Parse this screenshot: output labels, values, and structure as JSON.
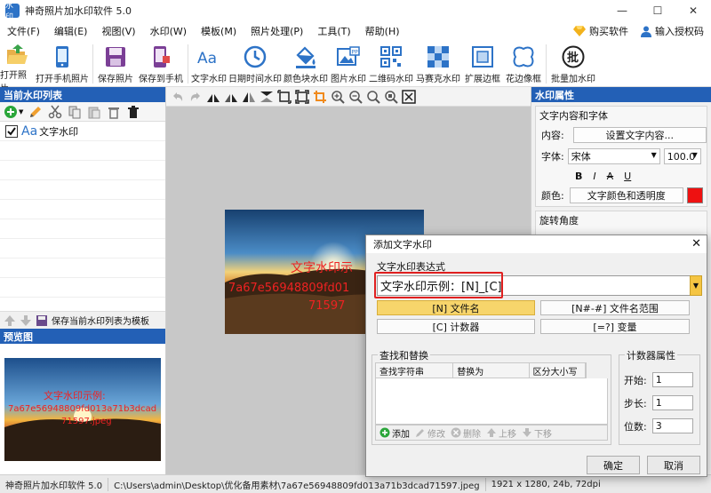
{
  "window": {
    "title": "神奇照片加水印软件 5.0",
    "icon_text": "水印",
    "minimize": "—",
    "maximize": "☐",
    "close": "✕"
  },
  "menu": {
    "items": [
      "文件(F)",
      "编辑(E)",
      "视图(V)",
      "水印(W)",
      "模板(M)",
      "照片处理(P)",
      "工具(T)",
      "帮助(H)"
    ],
    "buy": "购买软件",
    "license": "输入授权码"
  },
  "toolbar": {
    "open_photo": "打开照片",
    "open_phone_photo": "打开手机照片",
    "save_photo": "保存照片",
    "save_to_phone": "保存到手机",
    "text_watermark": "文字水印",
    "datetime_watermark": "日期时间水印",
    "color_block_watermark": "颜色块水印",
    "image_watermark": "图片水印",
    "qrcode_watermark": "二维码水印",
    "mosaic_watermark": "马赛克水印",
    "extend_border": "扩展边框",
    "lace_border": "花边像框",
    "batch_watermark": "批量加水印",
    "batch_icon_text": "批"
  },
  "left_panel": {
    "title": "当前水印列表",
    "items": [
      {
        "icon": "Aa",
        "label": "文字水印",
        "checked": true
      }
    ],
    "save_template": "保存当前水印列表为模板",
    "preview_title": "预览图"
  },
  "canvas": {
    "watermark_line1": "文字水印示",
    "watermark_line2": "7a67e56948809fd01",
    "watermark_line3": "71597",
    "thumb_line1": "文字水印示例:",
    "thumb_line2": "7a67e56948809fd013a71b3dcad",
    "thumb_line3": "71597.jpeg"
  },
  "right_panel": {
    "title": "水印属性",
    "group_title": "文字内容和字体",
    "content_label": "内容:",
    "set_content": "设置文字内容...",
    "font_label": "字体:",
    "font_value": "宋体",
    "font_size": "100.0",
    "style_buttons": [
      "B",
      "I",
      "A",
      "U"
    ],
    "color_label": "颜色:",
    "color_button": "文字颜色和透明度",
    "color_value": "#ee1111",
    "rotation_title": "旋转角度"
  },
  "status": {
    "app": "神奇照片加水印软件 5.0",
    "path": "C:\\Users\\admin\\Desktop\\优化备用素材\\7a67e56948809fd013a71b3dcad71597.jpeg",
    "info": "1921 x 1280, 24b, 72dpi"
  },
  "dialog": {
    "title": "添加文字水印",
    "close": "✕",
    "expr_label": "文字水印表达式",
    "expr_value": "文字水印示例：[N]_[C]",
    "macros": {
      "filename": "[N] 文件名",
      "filename_range": "[N#-#] 文件名范围",
      "counter": "[C] 计数器",
      "variable": "[=?] 变量"
    },
    "find_replace_title": "查找和替换",
    "columns": [
      "查找字符串",
      "替换为",
      "区分大小写"
    ],
    "grid_buttons": {
      "add": "添加",
      "edit": "修改",
      "delete": "删除",
      "up": "上移",
      "down": "下移"
    },
    "counter_title": "计数器属性",
    "counter_start_label": "开始:",
    "counter_start": "1",
    "counter_step_label": "步长:",
    "counter_step": "1",
    "counter_digits_label": "位数:",
    "counter_digits": "3",
    "ok": "确定",
    "cancel": "取消"
  }
}
